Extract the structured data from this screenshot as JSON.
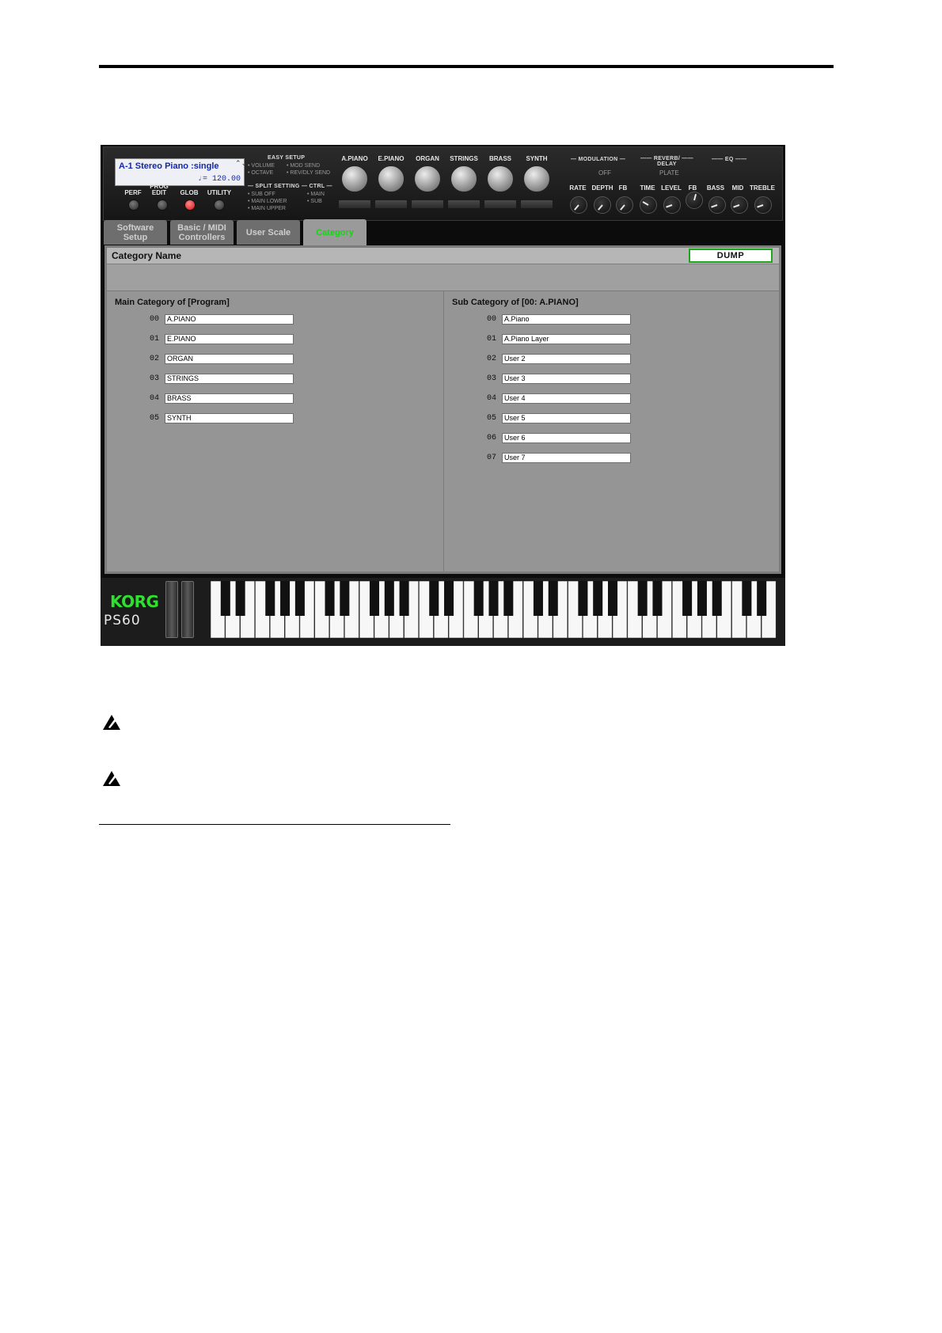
{
  "window": {
    "program": "A-1 Stereo Piano :single",
    "tempo": "♩= 120.00",
    "lcd_arrows": "⌃⌄"
  },
  "mode_buttons": [
    {
      "label": "PERF",
      "active": false
    },
    {
      "label": "PROG\nEDIT",
      "active": false
    },
    {
      "label": "GLOB",
      "active": true
    },
    {
      "label": "UTILITY",
      "active": false
    }
  ],
  "easy_setup": {
    "title": "EASY SETUP",
    "options": [
      "• VOLUME",
      "• MOD SEND",
      "• OCTAVE",
      "• REV/DLY SEND"
    ]
  },
  "split_setting": {
    "title": "— SPLIT SETTING",
    "options": [
      "• SUB OFF",
      "• MAIN LOWER",
      "• MAIN UPPER"
    ]
  },
  "ctrl": {
    "title": "— CTRL —",
    "options": [
      "• MAIN",
      "• SUB"
    ]
  },
  "category_knobs": [
    "A.PIANO",
    "E.PIANO",
    "ORGAN",
    "STRINGS",
    "BRASS",
    "SYNTH"
  ],
  "effects": {
    "modulation_title": "— MODULATION —",
    "modulation_value": "OFF",
    "reverb_title": "—— REVERB/ ——\nDELAY",
    "reverb_value": "PLATE",
    "eq_title": "—— EQ ——",
    "knob_labels": [
      "RATE",
      "DEPTH",
      "FB",
      "TIME",
      "LEVEL",
      "FB",
      "BASS",
      "MID",
      "TREBLE"
    ]
  },
  "tabs": [
    {
      "label": "Software\nSetup",
      "active": false
    },
    {
      "label": "Basic / MIDI\nControllers",
      "active": false
    },
    {
      "label": "User Scale",
      "active": false
    },
    {
      "label": "Category",
      "active": true
    }
  ],
  "category_name_label": "Category Name",
  "dump_button": "DUMP",
  "main_category": {
    "title": "Main Category of [Program]",
    "rows": [
      {
        "num": "00",
        "name": "A.PIANO"
      },
      {
        "num": "01",
        "name": "E.PIANO"
      },
      {
        "num": "02",
        "name": "ORGAN"
      },
      {
        "num": "03",
        "name": "STRINGS"
      },
      {
        "num": "04",
        "name": "BRASS"
      },
      {
        "num": "05",
        "name": "SYNTH"
      }
    ]
  },
  "sub_category": {
    "title": "Sub Category of [00: A.PIANO]",
    "rows": [
      {
        "num": "00",
        "name": "A.Piano"
      },
      {
        "num": "01",
        "name": "A.Piano Layer"
      },
      {
        "num": "02",
        "name": "User 2"
      },
      {
        "num": "03",
        "name": "User 3"
      },
      {
        "num": "04",
        "name": "User 4"
      },
      {
        "num": "05",
        "name": "User 5"
      },
      {
        "num": "06",
        "name": "User 6"
      },
      {
        "num": "07",
        "name": "User 7"
      }
    ]
  },
  "logo": {
    "brand": "KORG",
    "model": "PS60"
  },
  "colors": {
    "accent_green": "#19d219",
    "led_red": "#d41010",
    "lcd_text": "#1428a8"
  }
}
